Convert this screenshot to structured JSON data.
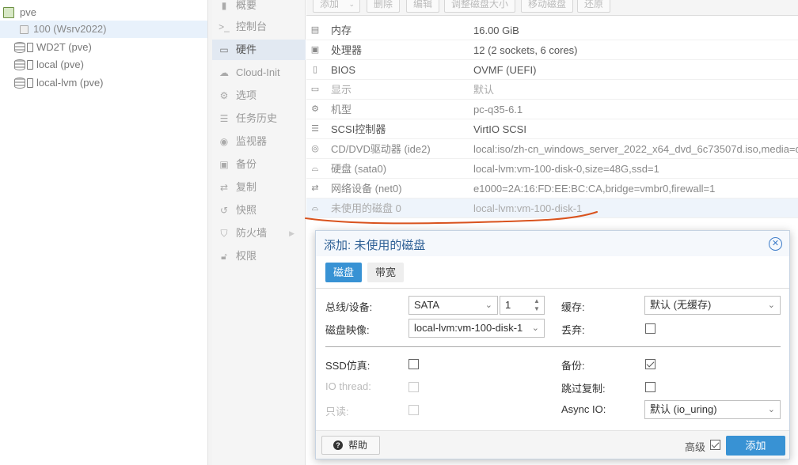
{
  "tree": {
    "items": [
      {
        "label": "pve",
        "icon": "server-icon"
      },
      {
        "label": "100 (Wsrv2022)",
        "icon": "vm-icon"
      },
      {
        "label": "WD2T (pve)",
        "icon": "storage-icon"
      },
      {
        "label": "local (pve)",
        "icon": "storage-icon"
      },
      {
        "label": "local-lvm (pve)",
        "icon": "storage-icon"
      }
    ]
  },
  "nav": {
    "items": [
      {
        "label": "概要",
        "icon": "book-icon"
      },
      {
        "label": "控制台",
        "icon": "terminal-icon"
      },
      {
        "label": "硬件",
        "icon": "monitor-icon"
      },
      {
        "label": "Cloud-Init",
        "icon": "cloud-icon"
      },
      {
        "label": "选项",
        "icon": "gear-icon"
      },
      {
        "label": "任务历史",
        "icon": "list-icon"
      },
      {
        "label": "监视器",
        "icon": "eye-icon"
      },
      {
        "label": "备份",
        "icon": "floppy-icon"
      },
      {
        "label": "复制",
        "icon": "retweet-icon"
      },
      {
        "label": "快照",
        "icon": "history-icon"
      },
      {
        "label": "防火墙",
        "icon": "shield-icon"
      },
      {
        "label": "权限",
        "icon": "unlock-icon"
      }
    ]
  },
  "toolbar": {
    "add": "添加",
    "remove": "删除",
    "edit": "编辑",
    "resize": "调整磁盘大小",
    "move": "移动磁盘",
    "revert": "还原"
  },
  "hardware": {
    "rows": [
      {
        "name": "内存",
        "value": "16.00 GiB",
        "icon": "memory-icon"
      },
      {
        "name": "处理器",
        "value": "12 (2 sockets, 6 cores)",
        "icon": "cpu-icon"
      },
      {
        "name": "BIOS",
        "value": "OVMF (UEFI)",
        "icon": "microchip-icon"
      },
      {
        "name": "显示",
        "value": "默认",
        "icon": "desktop-icon"
      },
      {
        "name": "机型",
        "value": "pc-q35-6.1",
        "icon": "cogs-icon"
      },
      {
        "name": "SCSI控制器",
        "value": "VirtIO SCSI",
        "icon": "database-icon"
      },
      {
        "name": "CD/DVD驱动器 (ide2)",
        "value": "local:iso/zh-cn_windows_server_2022_x64_dvd_6c73507d.iso,media=cdrom",
        "icon": "cdrom-icon"
      },
      {
        "name": "硬盘 (sata0)",
        "value": "local-lvm:vm-100-disk-0,size=48G,ssd=1",
        "icon": "hdd-icon"
      },
      {
        "name": "网络设备 (net0)",
        "value": "e1000=2A:16:FD:EE:BC:CA,bridge=vmbr0,firewall=1",
        "icon": "exchange-icon"
      },
      {
        "name": "未使用的磁盘 0",
        "value": "local-lvm:vm-100-disk-1",
        "icon": "hdd-icon"
      }
    ]
  },
  "dialog": {
    "title": "添加: 未使用的磁盘",
    "tabs": [
      "磁盘",
      "带宽"
    ],
    "bus_label": "总线/设备:",
    "bus_value": "SATA",
    "bus_index": "1",
    "image_label": "磁盘映像:",
    "image_value": "local-lvm:vm-100-disk-1",
    "cache_label": "缓存:",
    "cache_value": "默认 (无缓存)",
    "discard_label": "丢弃:",
    "ssd_label": "SSD仿真:",
    "iothread_label": "IO thread:",
    "readonly_label": "只读:",
    "backup_label": "备份:",
    "skip_repl_label": "跳过复制:",
    "async_label": "Async IO:",
    "async_value": "默认 (io_uring)",
    "help": "帮助",
    "advanced": "高级",
    "add": "添加"
  },
  "colors": {
    "accent": "#3892d4",
    "title": "#2d5f95",
    "annotation": "#d9531e"
  }
}
